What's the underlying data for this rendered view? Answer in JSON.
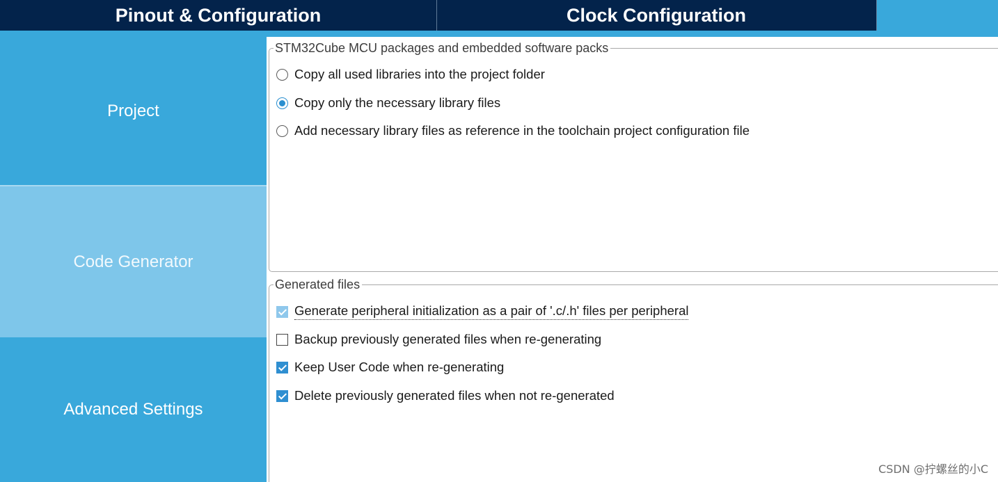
{
  "tabs": {
    "pinout": "Pinout & Configuration",
    "clock": "Clock Configuration"
  },
  "sidebar": {
    "items": [
      {
        "label": "Project",
        "selected": false
      },
      {
        "label": "Code Generator",
        "selected": true
      },
      {
        "label": "Advanced Settings",
        "selected": false
      }
    ]
  },
  "packages": {
    "title": "STM32Cube MCU packages and embedded software packs",
    "options": [
      {
        "label": "Copy all used libraries into the project folder",
        "selected": false
      },
      {
        "label": "Copy only the necessary library files",
        "selected": true
      },
      {
        "label": "Add necessary library files as reference in the toolchain project configuration file",
        "selected": false
      }
    ]
  },
  "generated": {
    "title": "Generated files",
    "options": [
      {
        "label": "Generate peripheral initialization as a pair of '.c/.h' files per peripheral",
        "checked": true,
        "disabled": true
      },
      {
        "label": "Backup previously generated files when re-generating",
        "checked": false
      },
      {
        "label": "Keep User Code when re-generating",
        "checked": true
      },
      {
        "label": "Delete previously generated files when not re-generated",
        "checked": true
      }
    ]
  },
  "watermark": "CSDN @拧螺丝的小C",
  "colors": {
    "topbar": "#03234b",
    "accent": "#39a8db",
    "selected_nav": "#7ec6ea",
    "checkbox": "#2f8fd1"
  }
}
